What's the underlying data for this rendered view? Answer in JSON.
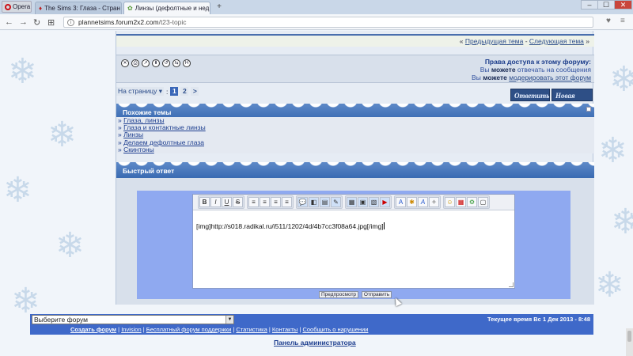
{
  "browser": {
    "app_name": "Opera",
    "tabs": [
      {
        "title": "The Sims 3: Глаза - Стран",
        "close": "×"
      },
      {
        "title": "Линзы (дефолтные и нед",
        "close": "×"
      }
    ],
    "new_tab": "+",
    "window_controls": [
      "‒",
      "☐",
      "✕"
    ],
    "back": "←",
    "forward": "→",
    "reload": "↻",
    "grid": "⊞",
    "url_domain": "plannetsims.forum2x2.com",
    "url_path": "/t23-topic",
    "bookmark": "♥",
    "downloads": "≡",
    "icons": [
      "opera-logo-icon",
      "info-icon",
      "heart-icon"
    ]
  },
  "nav": {
    "prev": "Предыдущая тема",
    "sep": " - ",
    "next": "Следующая тема",
    "open": "« ",
    "close": " »"
  },
  "permissions": {
    "title": "Права доступа к этому форуму:",
    "line1_pre": "Вы ",
    "line1_bold": "можете",
    "line1_post": " отвечать на сообщения",
    "line2_pre": "Вы ",
    "line2_bold": "можете",
    "line2_link": "модерировать этот форум"
  },
  "topic_tools": [
    "✕",
    "⎙",
    "↗",
    "⬇",
    "↺",
    "⇆",
    "H"
  ],
  "pagination": {
    "label": "На страницу ▾",
    "colon": " :",
    "pages": [
      "1",
      "2"
    ],
    "next": ">"
  },
  "buttons": {
    "reply": "Ответить",
    "new_topic": "Новая тема"
  },
  "similar": {
    "title": "Похожие темы",
    "items": [
      "Глаза, линзы",
      "Глаза и контактные линзы",
      "Линзы",
      "Делаем дефолтные глаза",
      "Скинтоны"
    ],
    "bullet": "» "
  },
  "quick_reply": {
    "title": "Быстрый ответ",
    "text": "[img]http://s018.radikal.ru/i511/1202/4d/4b7cc3f08a64.jpg[/img]",
    "preview_label": "Предпросмотр",
    "send_label": "Отправить",
    "toolbar_groups": [
      [
        "B",
        "I",
        "U",
        "S"
      ],
      [
        "≡",
        "≡",
        "≡",
        "≡"
      ],
      [
        "💬",
        "◧",
        "▤",
        "✎"
      ],
      [
        "▦",
        "▣",
        "▧",
        "▶"
      ],
      [
        "A",
        "✱",
        "A",
        "✧"
      ],
      [
        "☺",
        "▦",
        "⚙",
        "▢"
      ]
    ]
  },
  "footer": {
    "select_placeholder": "Выберите форум",
    "clock": "Текущее время Вс 1 Дек 2013 - 8:48",
    "links": [
      "Создать форум",
      "Invision",
      "Бесплатный форум поддержки",
      "Статистика",
      "Контакты",
      "Сообщить о нарушении"
    ],
    "link_sep": " | ",
    "admin_panel": "Панель администратора"
  },
  "colors": {
    "accent": "#3f69c9",
    "header_gradient": "#5d89c8",
    "link": "#1d3e8f",
    "editor_frame": "#8fa9f0"
  }
}
